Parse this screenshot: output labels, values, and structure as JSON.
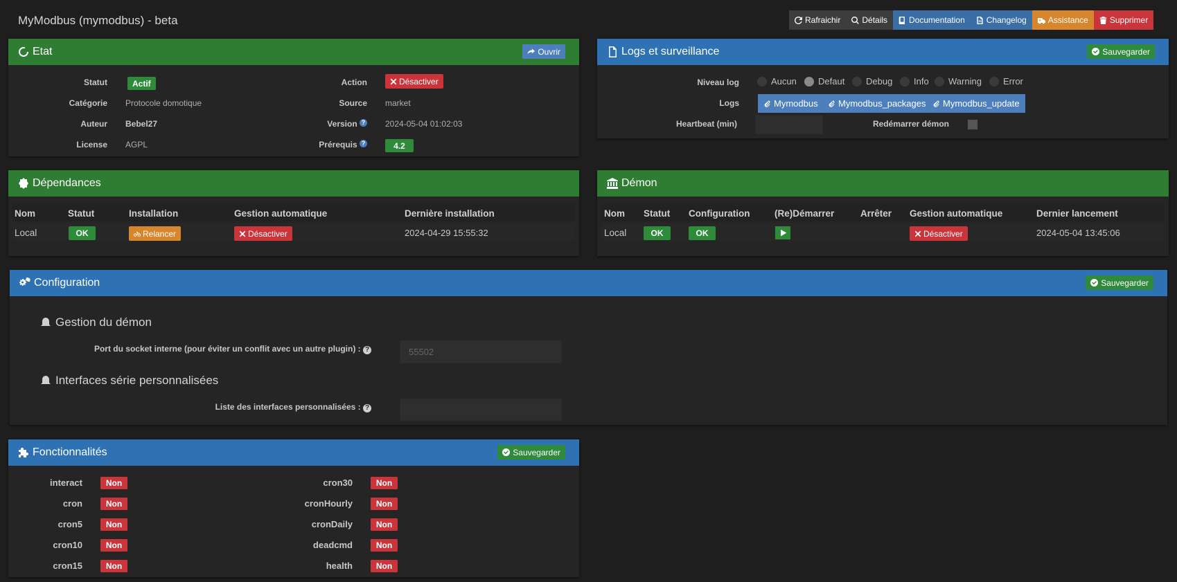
{
  "page": {
    "title": "MyModbus (mymodbus) - beta"
  },
  "toolbar": {
    "refresh": "Rafraichir",
    "details": "Détails",
    "documentation": "Documentation",
    "changelog": "Changelog",
    "assistance": "Assistance",
    "delete": "Supprimer"
  },
  "etat": {
    "title": "Etat",
    "open_button": "Ouvrir",
    "statut_label": "Statut",
    "statut_value": "Actif",
    "categorie_label": "Catégorie",
    "categorie_value": "Protocole domotique",
    "auteur_label": "Auteur",
    "auteur_value": "Bebel27",
    "license_label": "License",
    "license_value": "AGPL",
    "action_label": "Action",
    "action_button": "Désactiver",
    "source_label": "Source",
    "source_value": "market",
    "version_label": "Version",
    "version_value": "2024-05-04 01:02:03",
    "prerequis_label": "Prérequis",
    "prerequis_value": "4.2"
  },
  "logs": {
    "title": "Logs et surveillance",
    "save_button": "Sauvegarder",
    "niveau_label": "Niveau log",
    "levels": [
      "Aucun",
      "Defaut",
      "Debug",
      "Info",
      "Warning",
      "Error"
    ],
    "selected_level": "Defaut",
    "logs_label": "Logs",
    "log_buttons": [
      "Mymodbus",
      "Mymodbus_packages",
      "Mymodbus_update"
    ],
    "heartbeat_label": "Heartbeat (min)",
    "heartbeat_value": "",
    "restart_label": "Redémarrer démon"
  },
  "dependances": {
    "title": "Dépendances",
    "headers": [
      "Nom",
      "Statut",
      "Installation",
      "Gestion automatique",
      "Dernière installation"
    ],
    "row": {
      "nom": "Local",
      "statut": "OK",
      "installation": "Relancer",
      "gestion": "Désactiver",
      "derniere": "2024-04-29 15:55:32"
    }
  },
  "demon": {
    "title": "Démon",
    "headers": [
      "Nom",
      "Statut",
      "Configuration",
      "(Re)Démarrer",
      "Arrêter",
      "Gestion automatique",
      "Dernier lancement"
    ],
    "row": {
      "nom": "Local",
      "statut": "OK",
      "configuration": "OK",
      "gestion": "Désactiver",
      "dernier": "2024-05-04 13:45:06"
    }
  },
  "configuration": {
    "title": "Configuration",
    "save_button": "Sauvegarder",
    "section1": "Gestion du démon",
    "port_label": "Port du socket interne (pour éviter un conflit avec un autre plugin) :",
    "port_placeholder": "55502",
    "section2": "Interfaces série personnalisées",
    "list_label": "Liste des interfaces personnalisées :",
    "list_value": ""
  },
  "fonctionnalites": {
    "title": "Fonctionnalités",
    "save_button": "Sauvegarder",
    "left": [
      {
        "label": "interact",
        "value": "Non"
      },
      {
        "label": "cron",
        "value": "Non"
      },
      {
        "label": "cron5",
        "value": "Non"
      },
      {
        "label": "cron10",
        "value": "Non"
      },
      {
        "label": "cron15",
        "value": "Non"
      }
    ],
    "right": [
      {
        "label": "cron30",
        "value": "Non"
      },
      {
        "label": "cronHourly",
        "value": "Non"
      },
      {
        "label": "cronDaily",
        "value": "Non"
      },
      {
        "label": "deadcmd",
        "value": "Non"
      },
      {
        "label": "health",
        "value": "Non"
      }
    ]
  },
  "colors": {
    "green_header": "#2e7d32",
    "blue_header": "#2f72b3",
    "red": "#c9353b",
    "orange": "#d6862c"
  }
}
